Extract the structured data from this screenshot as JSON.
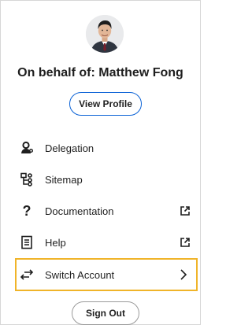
{
  "profile": {
    "behalf_text": "On behalf of: Matthew Fong",
    "view_profile_label": "View Profile"
  },
  "menu": {
    "items": [
      {
        "label": "Delegation",
        "icon": "delegation-icon"
      },
      {
        "label": "Sitemap",
        "icon": "sitemap-icon"
      },
      {
        "label": "Documentation",
        "icon": "question-icon",
        "trailing_icon": "external-link-icon"
      },
      {
        "label": "Help",
        "icon": "document-icon",
        "trailing_icon": "external-link-icon"
      },
      {
        "label": "Switch Account",
        "icon": "switch-arrows-icon",
        "trailing_icon": "chevron-right-icon",
        "highlighted": true
      }
    ]
  },
  "sign_out_label": "Sign Out",
  "colors": {
    "primary_border": "#0b62d6",
    "highlight_border": "#f0b429",
    "text": "#1f1f1f"
  }
}
